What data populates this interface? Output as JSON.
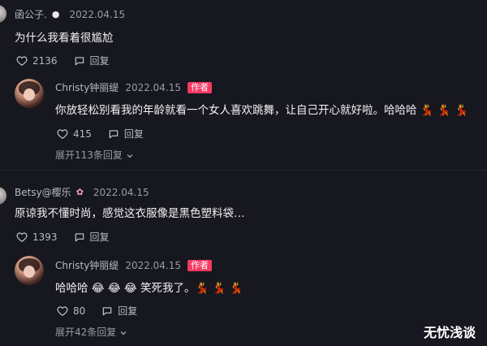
{
  "comments": [
    {
      "user": "函公子.",
      "date": "2022.04.15",
      "text": "为什么我看着很尴尬",
      "likes": "2136",
      "reply": "回复",
      "replies": [
        {
          "user": "Christy钟丽缇",
          "date": "2022.04.15",
          "badge": "作者",
          "text": "你放轻松别看我的年龄就看一个女人喜欢跳舞，让自己开心就好啦。哈哈哈 💃 💃 💃",
          "likes": "415",
          "reply": "回复"
        }
      ],
      "expand": "展开113条回复"
    },
    {
      "user": "Betsy@樱乐",
      "date": "2022.04.15",
      "text": "原谅我不懂时尚，感觉这衣服像是黑色塑料袋…",
      "likes": "1393",
      "reply": "回复",
      "replies": [
        {
          "user": "Christy钟丽缇",
          "date": "2022.04.15",
          "badge": "作者",
          "text": "哈哈哈 😂 😂 😂 笑死我了。💃 💃 💃",
          "likes": "80",
          "reply": "回复"
        }
      ],
      "expand": "展开42条回复"
    }
  ],
  "watermark": "无忧浅谈",
  "icons": [
    "heart-icon",
    "reply-icon",
    "chevron-down-icon"
  ],
  "colors": {
    "background": "#17171f",
    "badge": "#f53a63",
    "text": "#f2f2f5",
    "muted": "#9b9ba5"
  }
}
